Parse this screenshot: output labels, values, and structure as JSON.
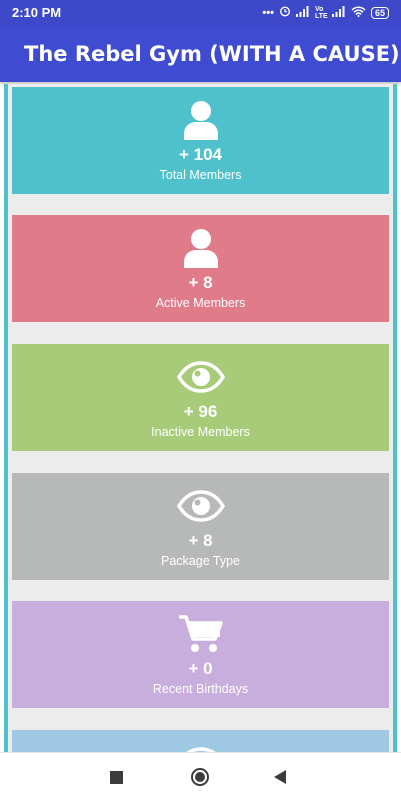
{
  "status_bar": {
    "time": "2:10 PM",
    "icons": [
      "dots-icon",
      "alarm-icon",
      "signal-icon",
      "volte-icon",
      "signal-icon",
      "wifi-icon",
      "battery-icon"
    ],
    "volte_text": "Vo LTE",
    "battery_level": "65"
  },
  "app_bar": {
    "title": "The Rebel Gym (WITH A CAUSE)"
  },
  "colors": {
    "primary": "#3f4bd0",
    "teal": "#4fc1cd",
    "pink": "#e07b8a",
    "green": "#a8cb7a",
    "gray": "#b7b8b8",
    "purple": "#c8aedc",
    "blue": "#9fc8e3"
  },
  "cards": [
    {
      "icon": "person-icon",
      "count": "+ 104",
      "label": "Total Members"
    },
    {
      "icon": "person-icon",
      "count": "+ 8",
      "label": "Active Members"
    },
    {
      "icon": "eye-icon",
      "count": "+ 96",
      "label": "Inactive Members"
    },
    {
      "icon": "eye-icon",
      "count": "+ 8",
      "label": "Package Type"
    },
    {
      "icon": "cart-icon",
      "count": "+ 0",
      "label": "Recent Birthdays"
    },
    {
      "icon": "eye-icon"
    }
  ],
  "nav_bar": {
    "buttons": [
      "recents-button",
      "home-button",
      "back-button"
    ]
  }
}
